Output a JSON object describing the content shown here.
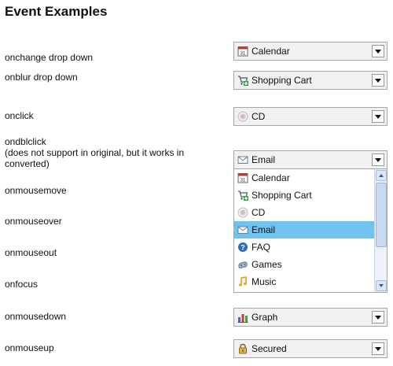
{
  "page": {
    "title": "Event Examples"
  },
  "rows": [
    {
      "label": "onchange drop down",
      "selected": "Calendar",
      "icon": "calendar-icon"
    },
    {
      "label": "onblur drop down",
      "selected": "Shopping Cart",
      "icon": "shopping-cart-icon"
    },
    {
      "label": "onclick",
      "selected": "CD",
      "icon": "cd-icon"
    },
    {
      "label_line1": "ondblclick",
      "label_line2": "(does not support in original, but it works in",
      "label_line3": "converted)",
      "selected": "Email",
      "icon": "email-icon"
    },
    {
      "label": "onmousemove"
    },
    {
      "label": "onmouseover"
    },
    {
      "label": "onmouseout"
    },
    {
      "label": "onfocus"
    },
    {
      "label": "onmousedown",
      "selected": "Graph",
      "icon": "graph-icon"
    },
    {
      "label": "onmouseup",
      "selected": "Secured",
      "icon": "lock-icon"
    }
  ],
  "open_list": {
    "items": [
      {
        "label": "Calendar",
        "icon": "calendar-icon"
      },
      {
        "label": "Shopping Cart",
        "icon": "shopping-cart-icon"
      },
      {
        "label": "CD",
        "icon": "cd-icon"
      },
      {
        "label": "Email",
        "icon": "email-icon",
        "highlighted": true
      },
      {
        "label": "FAQ",
        "icon": "faq-icon"
      },
      {
        "label": "Games",
        "icon": "games-icon"
      },
      {
        "label": "Music",
        "icon": "music-icon"
      }
    ],
    "highlight_color": "#6ec3f0"
  }
}
